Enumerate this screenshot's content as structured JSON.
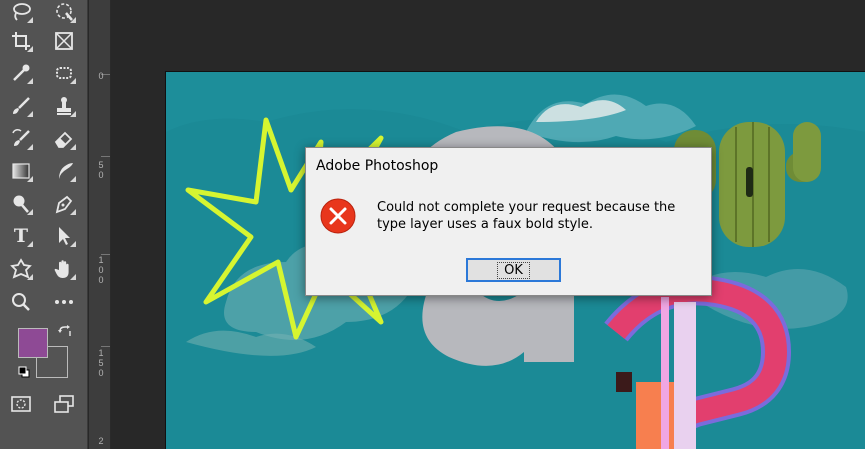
{
  "app": {
    "name": "Adobe Photoshop"
  },
  "toolbar": {
    "tools": [
      {
        "name": "lasso-tool",
        "icon": "lasso-icon"
      },
      {
        "name": "quick-selection-tool",
        "icon": "quick-selection-icon"
      },
      {
        "name": "crop-tool",
        "icon": "crop-icon"
      },
      {
        "name": "frame-tool",
        "icon": "frame-icon"
      },
      {
        "name": "eyedropper-tool",
        "icon": "eyedropper-icon"
      },
      {
        "name": "spot-healing-tool",
        "icon": "bandage-icon"
      },
      {
        "name": "brush-tool",
        "icon": "brush-icon"
      },
      {
        "name": "clone-stamp-tool",
        "icon": "stamp-icon"
      },
      {
        "name": "history-brush-tool",
        "icon": "history-brush-icon"
      },
      {
        "name": "eraser-tool",
        "icon": "eraser-icon"
      },
      {
        "name": "gradient-tool",
        "icon": "gradient-icon"
      },
      {
        "name": "blur-tool",
        "icon": "blur-icon"
      },
      {
        "name": "dodge-tool",
        "icon": "dodge-icon"
      },
      {
        "name": "pen-tool",
        "icon": "pen-icon"
      },
      {
        "name": "type-tool",
        "icon": "type-icon",
        "glyph": "T"
      },
      {
        "name": "path-selection-tool",
        "icon": "arrow-icon"
      },
      {
        "name": "shape-tool",
        "icon": "shape-icon"
      },
      {
        "name": "hand-tool",
        "icon": "hand-icon"
      },
      {
        "name": "zoom-tool",
        "icon": "zoom-icon"
      },
      {
        "name": "more-tools",
        "icon": "ellipsis-icon"
      }
    ],
    "foreground_color": "#8e4a95",
    "background_color": "#545454"
  },
  "ruler": {
    "labels": [
      "0",
      "5 0",
      "1 0 0",
      "1 5 0",
      "2"
    ]
  },
  "dialog": {
    "title": "Adobe Photoshop",
    "message": "Could not complete your request because the type layer uses a faux bold style.",
    "ok_label": "OK",
    "icon": "error-icon"
  },
  "colors": {
    "canvas_teal": "#1a8b97",
    "neon_yellow": "#d6f531",
    "accent_blue": "#2b78d8",
    "error_red": "#e8361c"
  }
}
